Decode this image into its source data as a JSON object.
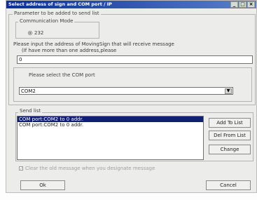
{
  "window": {
    "title": "Select address of sign and COM port / IP"
  },
  "titlebar_buttons": {
    "minimize": "_",
    "maximize": "□",
    "close": "×"
  },
  "params": {
    "group_title": "Parameter to be added to send list",
    "comm_group_title": "Communication Mode",
    "radio_label": "232",
    "address_prompt_1": "Please input the address of MovingSign that will receive message",
    "address_prompt_2": "(If have more than one address,please",
    "address_value": "0",
    "com_group_title": "Please select the COM port",
    "com_value": "COM2"
  },
  "send_list": {
    "title": "Send list",
    "items": [
      "COM port:COM2 to 0 addr.",
      "COM port:COM2 to 0 addr."
    ],
    "selected_index": 0
  },
  "buttons": {
    "add": "Add To List",
    "delete": "Del From List",
    "change": "Change",
    "ok": "Ok",
    "cancel": "Cancel"
  },
  "checkbox": {
    "label": "Clear the old message when you designate message",
    "checked": true
  }
}
